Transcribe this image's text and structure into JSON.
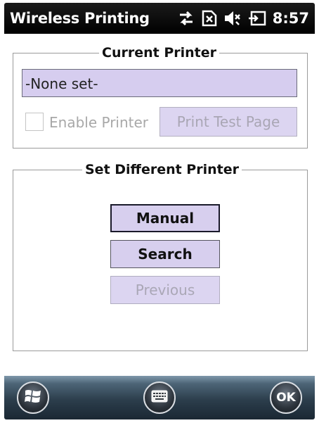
{
  "titlebar": {
    "title": "Wireless Printing",
    "time": "8:57",
    "icons": [
      "sync-arrows-icon",
      "no-sim-icon",
      "speaker-muted-icon",
      "battery-charging-icon"
    ]
  },
  "current_printer": {
    "legend": "Current Printer",
    "printer_value": "-None set-",
    "enable_label": "Enable Printer",
    "enable_checked": false,
    "print_test_label": "Print Test Page"
  },
  "set_different": {
    "legend": "Set Different Printer",
    "manual_label": "Manual",
    "search_label": "Search",
    "previous_label": "Previous"
  },
  "softkeys": {
    "left": "windows-start-icon",
    "center": "keyboard-icon",
    "right_label": "OK"
  },
  "colors": {
    "field_fill": "#d6cdef",
    "button_fill": "#d7cfee",
    "disabled_text": "#a8a8a8",
    "titlebar_bg": "#000000"
  }
}
